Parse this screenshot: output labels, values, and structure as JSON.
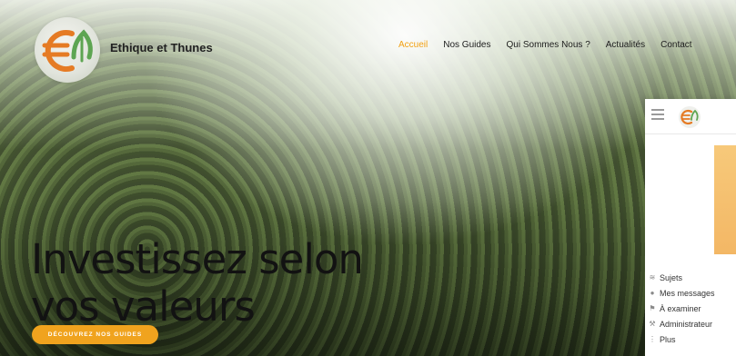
{
  "site": {
    "brand_name": "Ethique et Thunes"
  },
  "nav": {
    "items": [
      "Accueil",
      "Nos Guides",
      "Qui Sommes Nous ?",
      "Actualités",
      "Contact"
    ],
    "active_index": 0
  },
  "hero": {
    "headline_line1": "Investissez selon",
    "headline_line2": "vos valeurs",
    "cta_label": "DÉCOUVREZ NOS GUIDES"
  },
  "panel": {
    "menu": [
      {
        "icon": "layers-icon",
        "label": "Sujets"
      },
      {
        "icon": "user-icon",
        "label": "Mes messages"
      },
      {
        "icon": "flag-icon",
        "label": "À examiner"
      },
      {
        "icon": "wrench-icon",
        "label": "Administrateur"
      },
      {
        "icon": "more-vertical-icon",
        "label": "Plus"
      }
    ]
  },
  "colors": {
    "accent": "#f2a114",
    "logo_green": "#5ea552",
    "logo_orange": "#e57b24"
  }
}
